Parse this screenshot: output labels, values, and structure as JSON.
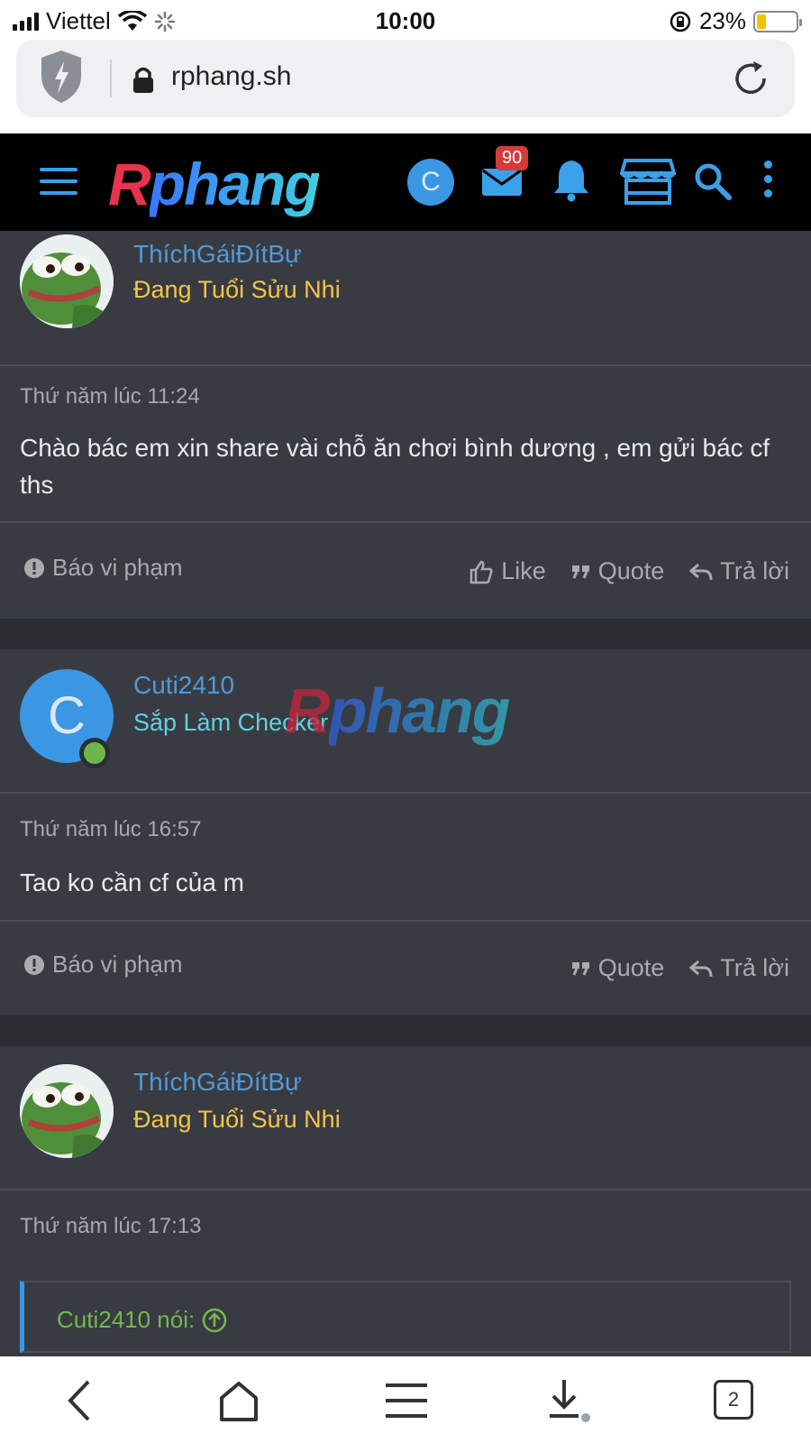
{
  "status_bar": {
    "carrier": "Viettel",
    "time": "10:00",
    "battery": "23%"
  },
  "browser": {
    "url": "rphang.sh"
  },
  "site_header": {
    "logo_r": "R",
    "logo_rest": "phang",
    "user_initial": "C",
    "inbox_badge": "90"
  },
  "posts": [
    {
      "username": "ThíchGáiĐítBự",
      "user_title": "Đang Tuổi Sửu Nhi",
      "user_title_color": "#f3c644",
      "time": "Thứ năm lúc 11:24",
      "message": "Chào bác em xin share vài chỗ ăn chơi bình dương , em gửi bác cf ths",
      "report_label": "Báo vi phạm",
      "like_label": "Like",
      "quote_label": "Quote",
      "reply_label": "Trả lời"
    },
    {
      "username": "Cuti2410",
      "avatar_initial": "C",
      "user_title": "Sắp Làm Checker",
      "user_title_color": "#5fd2e2",
      "time": "Thứ năm lúc 16:57",
      "message": "Tao ko cần cf của m",
      "report_label": "Báo vi phạm",
      "quote_label": "Quote",
      "reply_label": "Trả lời"
    },
    {
      "username": "ThíchGáiĐítBự",
      "user_title": "Đang Tuổi Sửu Nhi",
      "user_title_color": "#f3c644",
      "time": "Thứ năm lúc 17:13",
      "quote_source": "Cuti2410 nói:"
    }
  ],
  "watermark": {
    "r": "R",
    "rest": "phang"
  },
  "toolbar": {
    "tab_count": "2"
  }
}
